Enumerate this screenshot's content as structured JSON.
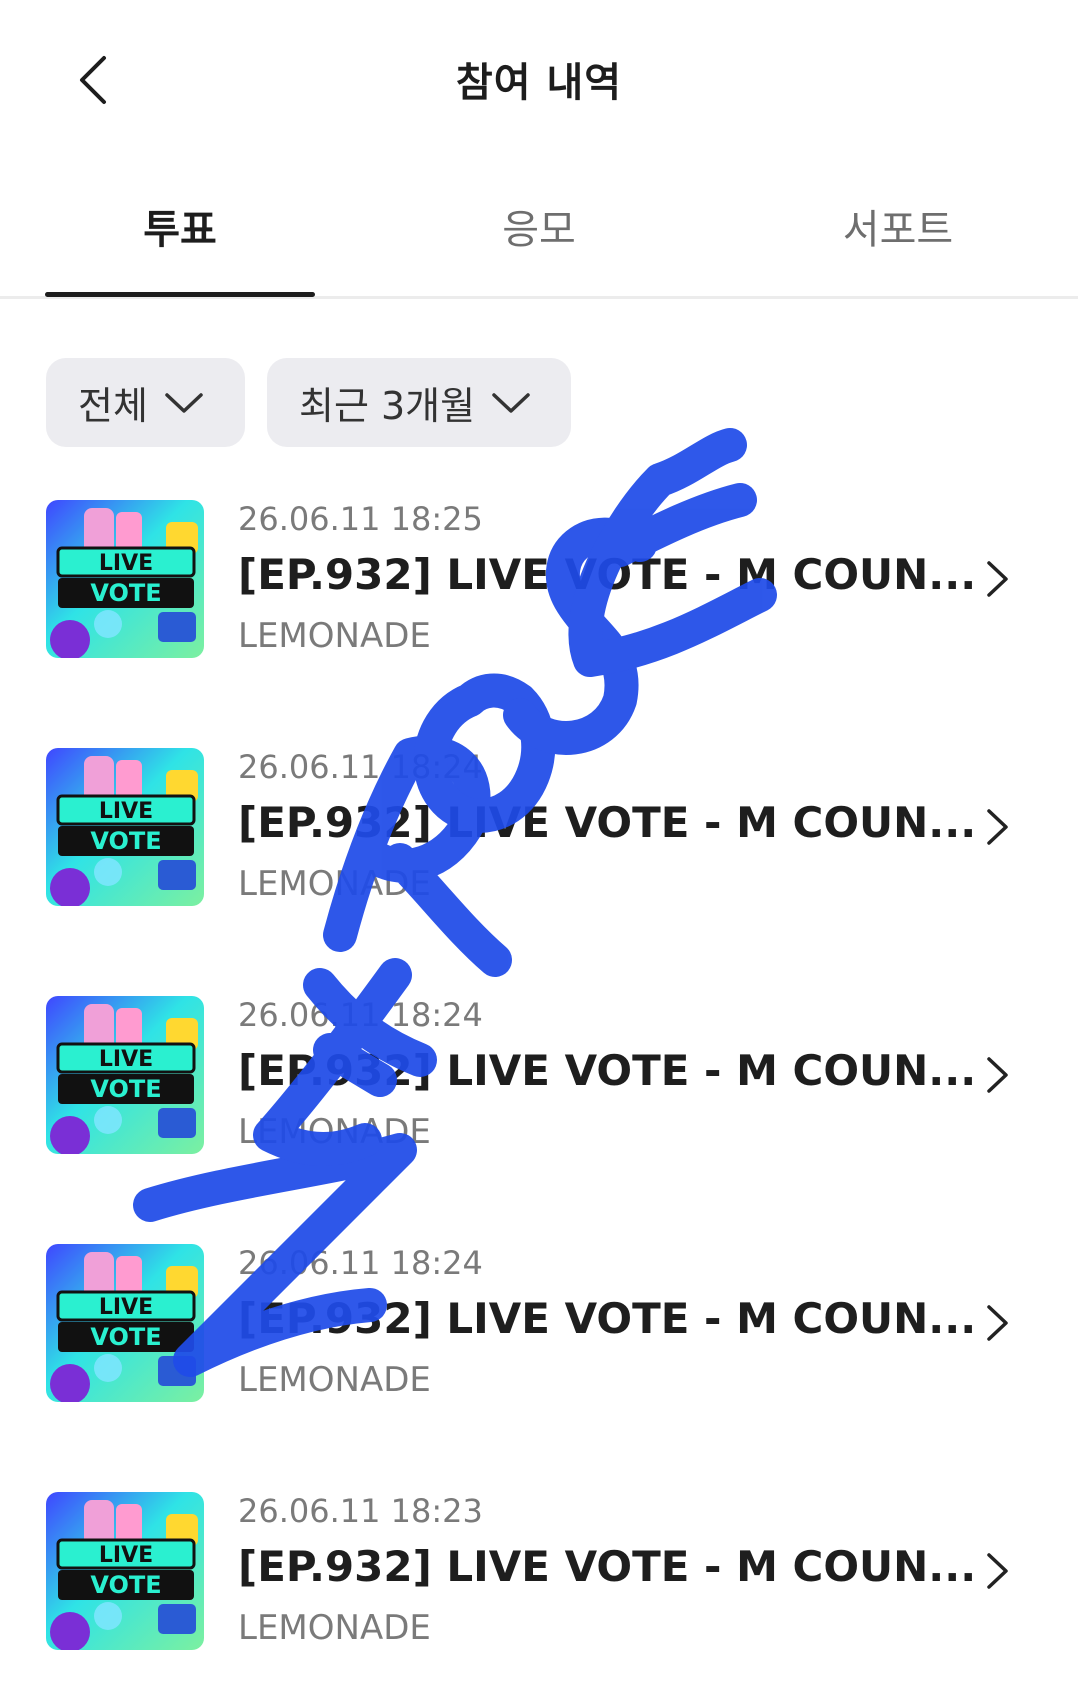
{
  "header": {
    "back_icon": "chevron-left-icon",
    "title": "참여 내역"
  },
  "tabs": [
    {
      "label": "투표",
      "active": true
    },
    {
      "label": "응모",
      "active": false
    },
    {
      "label": "서포트",
      "active": false
    }
  ],
  "filters": [
    {
      "label": "전체",
      "icon": "chevron-down-icon"
    },
    {
      "label": "최근 3개월",
      "icon": "chevron-down-icon"
    }
  ],
  "thumbnail": {
    "line1": "LIVE",
    "line2": "VOTE"
  },
  "items": [
    {
      "date": "26.06.11 18:25",
      "title": "[EP.932] LIVE VOTE - M COUN...",
      "artist": "LEMONADE"
    },
    {
      "date": "26.06.11 18:24",
      "title": "[EP.932] LIVE VOTE - M COUN...",
      "artist": "LEMONADE"
    },
    {
      "date": "26.06.11 18:24",
      "title": "[EP.932] LIVE VOTE - M COUN...",
      "artist": "LEMONADE"
    },
    {
      "date": "26.06.11 18:24",
      "title": "[EP.932] LIVE VOTE - M COUN...",
      "artist": "LEMONADE"
    },
    {
      "date": "26.06.11 18:23",
      "title": "[EP.932] LIVE VOTE - M COUN...",
      "artist": "LEMONADE"
    }
  ],
  "watermark": {
    "text": "ZEROSE",
    "color": "#1f4be8"
  },
  "colors": {
    "active_tab": "#1d1d1d",
    "filter_bg": "#ececf0",
    "muted_text": "#7a7a7a"
  }
}
